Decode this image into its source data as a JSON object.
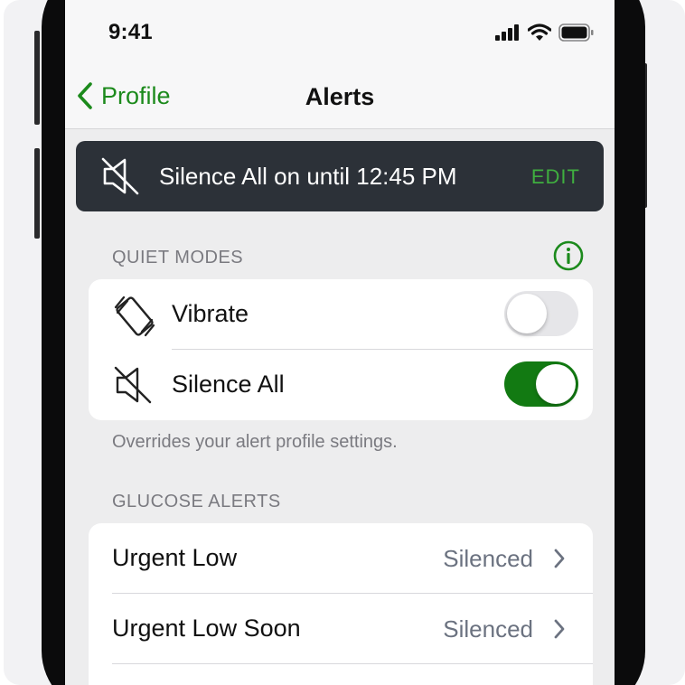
{
  "status": {
    "time": "9:41"
  },
  "nav": {
    "back_label": "Profile",
    "title": "Alerts"
  },
  "banner": {
    "text": "Silence All on until 12:45 PM",
    "action": "EDIT",
    "icon": "speaker-muted-icon"
  },
  "quiet_modes": {
    "header": "QUIET MODES",
    "items": [
      {
        "label": "Vibrate",
        "icon": "vibrate-icon",
        "enabled": false
      },
      {
        "label": "Silence All",
        "icon": "speaker-muted-icon",
        "enabled": true
      }
    ],
    "footnote": "Overrides your alert profile settings."
  },
  "glucose_alerts": {
    "header": "GLUCOSE ALERTS",
    "items": [
      {
        "label": "Urgent Low",
        "value": "Silenced"
      },
      {
        "label": "Urgent Low Soon",
        "value": "Silenced"
      }
    ]
  },
  "colors": {
    "accent": "#1c8a1c",
    "toggle_on": "#127a12",
    "banner_bg": "#2c3138"
  }
}
